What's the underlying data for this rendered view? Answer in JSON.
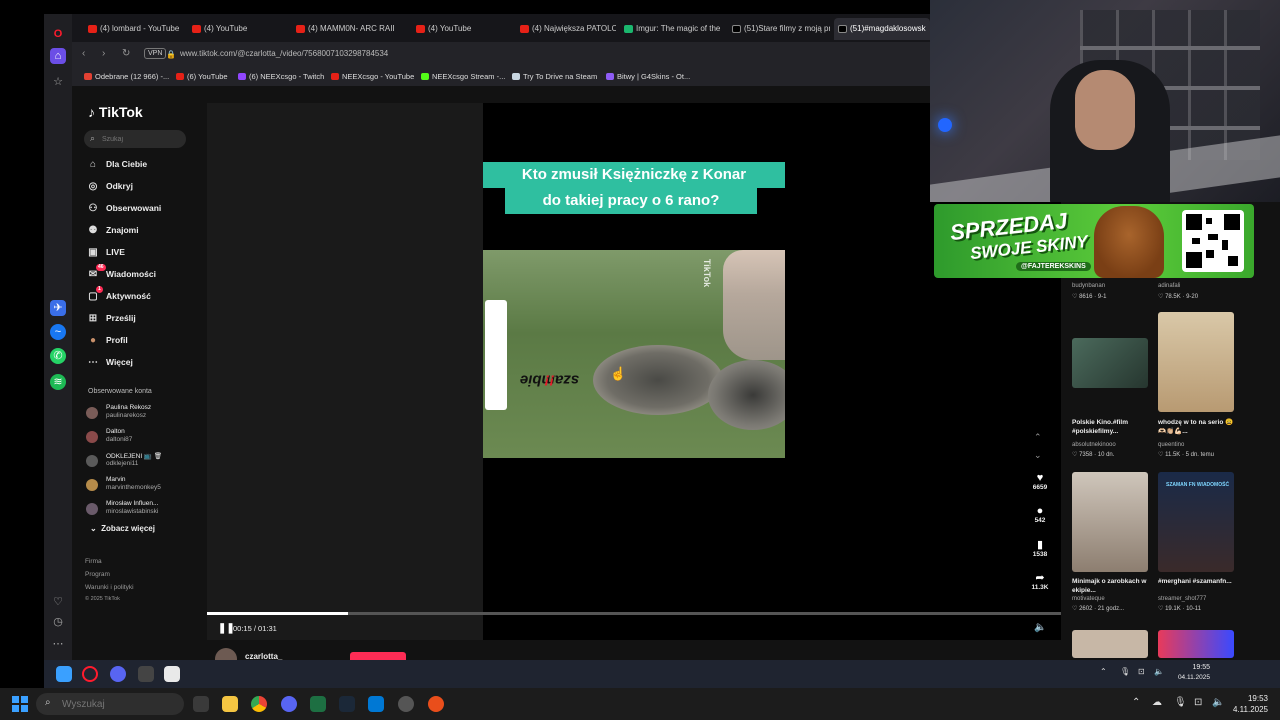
{
  "browser": {
    "tabs": [
      {
        "label": "(4) lombard - YouTube",
        "active": false
      },
      {
        "label": "(4) YouTube",
        "active": false
      },
      {
        "label": "(4) MAMM0N- ARC RAIDE",
        "active": false
      },
      {
        "label": "(4) YouTube",
        "active": false
      },
      {
        "label": "(4) Największa PATOLOGI",
        "active": false
      },
      {
        "label": "Imgur: The magic of the I",
        "active": false
      },
      {
        "label": "(51)Stare filmy z moją prz",
        "active": false
      },
      {
        "label": "(51)#magdaklosowsk",
        "active": true
      }
    ],
    "vpn_label": "VPN",
    "url": "www.tiktok.com/@czarlotta_/video/7568007103298784534",
    "bookmarks": [
      "Odebrane (12 966) -...",
      "(6) YouTube",
      "(6) NEEXcsgo - Twitch",
      "NEEXcsgo - YouTube",
      "NEEXcsgo Stream -...",
      "Try To Drive na Steam",
      "Bitwy | G4Skins - Ot..."
    ]
  },
  "tiktok": {
    "logo": "TikTok",
    "search_placeholder": "Szukaj",
    "menu": [
      {
        "label": "Dla Ciebie",
        "icon": "home-icon"
      },
      {
        "label": "Odkryj",
        "icon": "compass-icon"
      },
      {
        "label": "Obserwowani",
        "icon": "follow-icon"
      },
      {
        "label": "Znajomi",
        "icon": "friends-icon"
      },
      {
        "label": "LIVE",
        "icon": "live-icon"
      },
      {
        "label": "Wiadomości",
        "icon": "message-icon",
        "badge": "46"
      },
      {
        "label": "Aktywność",
        "icon": "activity-icon",
        "badge": "1"
      },
      {
        "label": "Prześlij",
        "icon": "upload-icon"
      },
      {
        "label": "Profil",
        "icon": "profile-icon"
      },
      {
        "label": "Więcej",
        "icon": "more-icon"
      }
    ],
    "followed_title": "Obserwowane konta",
    "followed": [
      {
        "name": "Paulina Rekosz",
        "handle": "paulinarekosz"
      },
      {
        "name": "Dalton",
        "handle": "daltoni87"
      },
      {
        "name": "ODKLEJENI 📺 🗑",
        "handle": "odklejeni11"
      },
      {
        "name": "Marvin",
        "handle": "marvinthemonkey5"
      },
      {
        "name": "Mirosław Influen...",
        "handle": "miroslawistabinski"
      }
    ],
    "see_more": "Zobacz więcej",
    "footer": [
      "Firma",
      "Program",
      "Warunki i polityki",
      "© 2025 TikTok"
    ]
  },
  "video": {
    "caption_line1": "Kto zmusił Księżniczkę z Konar",
    "caption_line2": "do takiej pracy o 6 rano?",
    "sticker_text": "szambie",
    "sticker_excl": "!!",
    "watermark": "TikTok",
    "progress": 0.165,
    "time": "00:15 / 01:31",
    "author": "czarlotta_",
    "likes": "6659",
    "comments": "542",
    "saves": "1538",
    "shares": "11.3K"
  },
  "right": {
    "top_left_user": "budynbanan",
    "top_left_stats": "8616 · 9-1",
    "top_right_user": "adinafali",
    "top_right_stats": "78.5K · 9-20",
    "cards": [
      {
        "title": "Polskie Kino.#film #polskiefilmy...",
        "user": "absolutnekinooo",
        "stats": "7358 · 10 dn."
      },
      {
        "title": "whodzę w to na serio 😩🫶🏻👏🏼💪🏻...",
        "user": "queentino",
        "stats": "11.5K · 5 dn. temu"
      },
      {
        "title": "Minimajk o zarobkach w ekipie...",
        "user": "motivateque",
        "stats": "2602 · 21 godz..."
      },
      {
        "title": "#merghani #szamanfn...",
        "user": "streamer_shot777",
        "stats": "19.1K · 10-11"
      }
    ],
    "card_thumb_text1": "SZAMAN FN WIADOMOŚĆ"
  },
  "promo": {
    "line1": "SPRZEDAJ",
    "line2": "SWOJE SKINY",
    "handle": "@FAJTEREKSKINS"
  },
  "inner_clock": {
    "time": "19:55",
    "date": "04.11.2025"
  },
  "taskbar": {
    "search_placeholder": "Wyszukaj",
    "time": "19:53",
    "date": "4.11.2025"
  }
}
